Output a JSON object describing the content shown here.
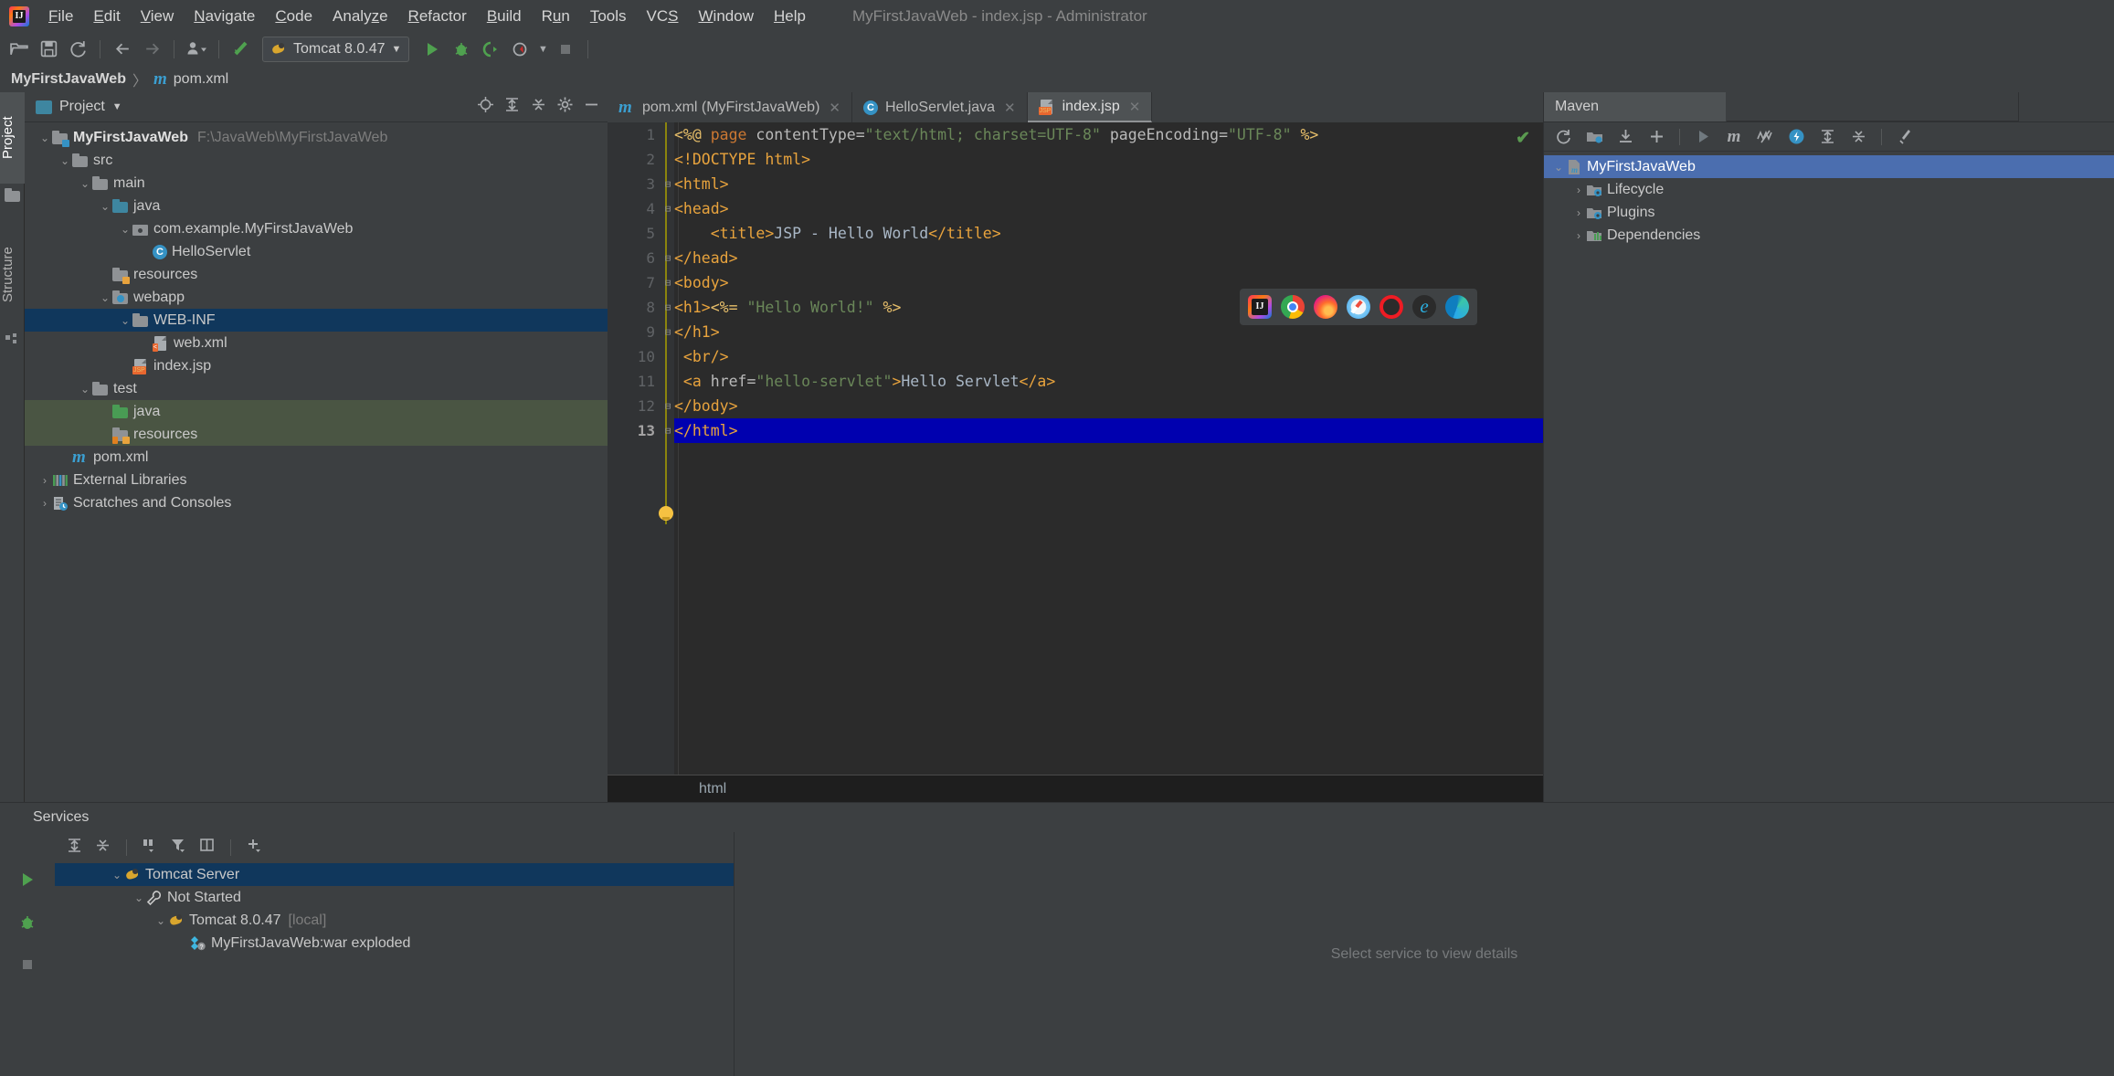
{
  "window": {
    "title": "MyFirstJavaWeb - index.jsp - Administrator"
  },
  "menubar": {
    "items": [
      {
        "label": "File",
        "mnemonic": "F"
      },
      {
        "label": "Edit",
        "mnemonic": "E"
      },
      {
        "label": "View",
        "mnemonic": "V"
      },
      {
        "label": "Navigate",
        "mnemonic": "N"
      },
      {
        "label": "Code",
        "mnemonic": "C"
      },
      {
        "label": "Analyze",
        "mnemonic": "z"
      },
      {
        "label": "Refactor",
        "mnemonic": "R"
      },
      {
        "label": "Build",
        "mnemonic": "B"
      },
      {
        "label": "Run",
        "mnemonic": "u"
      },
      {
        "label": "Tools",
        "mnemonic": "T"
      },
      {
        "label": "VCS",
        "mnemonic": "S"
      },
      {
        "label": "Window",
        "mnemonic": "W"
      },
      {
        "label": "Help",
        "mnemonic": "H"
      }
    ]
  },
  "toolbar": {
    "icons": [
      "open-folder-icon",
      "save-all-icon",
      "sync-refresh-icon",
      "back-arrow-icon",
      "forward-arrow-icon",
      "update-project-icon",
      "make-project-icon"
    ],
    "run_config": {
      "label": "Tomcat 8.0.47",
      "icon": "tomcat-icon",
      "dropdown": "chevron-down-icon"
    },
    "run_icons": [
      "run-icon",
      "debug-icon",
      "run-with-coverage-icon",
      "profile-icon",
      "stop-icon"
    ]
  },
  "breadcrumb": {
    "project": "MyFirstJavaWeb",
    "separator": "〉",
    "file": "pom.xml",
    "file_icon": "maven-m-icon"
  },
  "left_strip": {
    "tabs": [
      {
        "label": "Project",
        "selected": true,
        "icon": "project-folder-icon"
      },
      {
        "label": "Structure",
        "selected": false,
        "icon": "structure-icon"
      }
    ]
  },
  "project_pane": {
    "title": "Project",
    "dropdown_icon": "chevron-down-icon",
    "head_icons": [
      "locate-target-icon",
      "expand-all-icon",
      "collapse-all-icon",
      "gear-icon",
      "hide-icon"
    ],
    "tree": [
      {
        "indent": 0,
        "arrow": "down",
        "icon": "module-folder-icon",
        "label": "MyFirstJavaWeb",
        "bold": true,
        "path": "F:\\JavaWeb\\MyFirstJavaWeb",
        "state": "none"
      },
      {
        "indent": 1,
        "arrow": "down",
        "icon": "folder-icon",
        "label": "src",
        "bold": false,
        "path": "",
        "state": "none"
      },
      {
        "indent": 2,
        "arrow": "down",
        "icon": "folder-icon",
        "label": "main",
        "bold": false,
        "path": "",
        "state": "none"
      },
      {
        "indent": 3,
        "arrow": "down",
        "icon": "source-folder-icon",
        "label": "java",
        "bold": false,
        "path": "",
        "state": "none"
      },
      {
        "indent": 4,
        "arrow": "down",
        "icon": "package-icon",
        "label": "com.example.MyFirstJavaWeb",
        "bold": false,
        "path": "",
        "state": "none"
      },
      {
        "indent": 5,
        "arrow": "none",
        "icon": "java-class-icon",
        "label": "HelloServlet",
        "bold": false,
        "path": "",
        "state": "none"
      },
      {
        "indent": 3,
        "arrow": "none",
        "icon": "resources-folder-icon",
        "label": "resources",
        "bold": false,
        "path": "",
        "state": "none"
      },
      {
        "indent": 3,
        "arrow": "down",
        "icon": "webapp-folder-icon",
        "label": "webapp",
        "bold": false,
        "path": "",
        "state": "none"
      },
      {
        "indent": 4,
        "arrow": "down",
        "icon": "folder-icon",
        "label": "WEB-INF",
        "bold": false,
        "path": "",
        "state": "selected-blue"
      },
      {
        "indent": 5,
        "arrow": "none",
        "icon": "xml-file-icon",
        "label": "web.xml",
        "bold": false,
        "path": "",
        "state": "none"
      },
      {
        "indent": 4,
        "arrow": "none",
        "icon": "jsp-file-icon",
        "label": "index.jsp",
        "bold": false,
        "path": "",
        "state": "none"
      },
      {
        "indent": 2,
        "arrow": "down",
        "icon": "folder-icon",
        "label": "test",
        "bold": false,
        "path": "",
        "state": "none"
      },
      {
        "indent": 3,
        "arrow": "none",
        "icon": "test-source-folder-icon",
        "label": "java",
        "bold": false,
        "path": "",
        "state": "selected-green"
      },
      {
        "indent": 3,
        "arrow": "none",
        "icon": "test-resources-folder-icon",
        "label": "resources",
        "bold": false,
        "path": "",
        "state": "selected-green"
      },
      {
        "indent": 1,
        "arrow": "none",
        "icon": "maven-m-icon",
        "label": "pom.xml",
        "bold": false,
        "path": "",
        "state": "none"
      },
      {
        "indent": 0,
        "arrow": "right",
        "icon": "external-libraries-icon",
        "label": "External Libraries",
        "bold": false,
        "path": "",
        "state": "none"
      },
      {
        "indent": 0,
        "arrow": "right",
        "icon": "scratches-icon",
        "label": "Scratches and Consoles",
        "bold": false,
        "path": "",
        "state": "none"
      }
    ]
  },
  "editor": {
    "tabs": [
      {
        "label": "pom.xml (MyFirstJavaWeb)",
        "icon": "maven-m-icon",
        "active": false,
        "close": "close-icon"
      },
      {
        "label": "HelloServlet.java",
        "icon": "java-class-icon",
        "active": false,
        "close": "close-icon"
      },
      {
        "label": "index.jsp",
        "icon": "jsp-file-icon",
        "active": true,
        "close": "close-icon"
      }
    ],
    "current_line": 13,
    "inspection_status": "ok-checkmark-icon",
    "bottom_breadcrumb": "html",
    "browser_popup": {
      "icons": [
        {
          "name": "intellij-browser-icon",
          "color": "#e6387f"
        },
        {
          "name": "chrome-browser-icon",
          "color": "#4285f4"
        },
        {
          "name": "firefox-browser-icon",
          "color": "#ff7139"
        },
        {
          "name": "safari-browser-icon",
          "color": "#3fa9f5"
        },
        {
          "name": "opera-browser-icon",
          "color": "#ee1c24"
        },
        {
          "name": "internet-explorer-browser-icon",
          "color": "#2baee0"
        },
        {
          "name": "edge-browser-icon",
          "color": "#28a8ea"
        }
      ]
    },
    "lines": [
      {
        "n": 1,
        "fold": "",
        "segs": [
          {
            "t": "<%@ ",
            "c": "tag"
          },
          {
            "t": "page ",
            "c": "kw"
          },
          {
            "t": "contentType=",
            "c": "attr"
          },
          {
            "t": "\"text/html; charset=UTF-8\"",
            "c": "str"
          },
          {
            "t": " ",
            "c": "attr"
          },
          {
            "t": "pageEncoding=",
            "c": "attr"
          },
          {
            "t": "\"UTF-8\"",
            "c": "str"
          },
          {
            "t": " %>",
            "c": "tag"
          }
        ]
      },
      {
        "n": 2,
        "fold": "",
        "segs": [
          {
            "t": "<!DOCTYPE html>",
            "c": "tagb"
          }
        ]
      },
      {
        "n": 3,
        "fold": "minus",
        "segs": [
          {
            "t": "<html>",
            "c": "tagb"
          }
        ]
      },
      {
        "n": 4,
        "fold": "minus",
        "segs": [
          {
            "t": "<head>",
            "c": "tagb"
          }
        ]
      },
      {
        "n": 5,
        "fold": "",
        "segs": [
          {
            "t": "    <title>",
            "c": "tagb"
          },
          {
            "t": "JSP - Hello World",
            "c": "txt"
          },
          {
            "t": "</title>",
            "c": "tagb"
          }
        ]
      },
      {
        "n": 6,
        "fold": "end",
        "segs": [
          {
            "t": "</head>",
            "c": "tagb"
          }
        ]
      },
      {
        "n": 7,
        "fold": "minus",
        "segs": [
          {
            "t": "<body>",
            "c": "tagb"
          }
        ]
      },
      {
        "n": 8,
        "fold": "minus",
        "segs": [
          {
            "t": "<h1>",
            "c": "tagb"
          },
          {
            "t": "<%= ",
            "c": "tag"
          },
          {
            "t": "\"Hello World!\"",
            "c": "str"
          },
          {
            "t": " %>",
            "c": "tag"
          }
        ]
      },
      {
        "n": 9,
        "fold": "end",
        "segs": [
          {
            "t": "</h1>",
            "c": "tagb"
          }
        ]
      },
      {
        "n": 10,
        "fold": "",
        "segs": [
          {
            "t": " <br/>",
            "c": "tagb"
          }
        ]
      },
      {
        "n": 11,
        "fold": "",
        "segs": [
          {
            "t": " <a ",
            "c": "tagb"
          },
          {
            "t": "href=",
            "c": "attr"
          },
          {
            "t": "\"hello-servlet\"",
            "c": "str"
          },
          {
            "t": ">",
            "c": "tagb"
          },
          {
            "t": "Hello Servlet",
            "c": "txt"
          },
          {
            "t": "</a>",
            "c": "tagb"
          }
        ]
      },
      {
        "n": 12,
        "fold": "end",
        "segs": [
          {
            "t": "</body>",
            "c": "tagb"
          }
        ]
      },
      {
        "n": 13,
        "fold": "end",
        "segs": [
          {
            "t": "</html>",
            "c": "tagb"
          }
        ]
      }
    ]
  },
  "maven_pane": {
    "tab_label": "Maven",
    "toolbar_icons": [
      "reimport-icon",
      "generate-sources-icon",
      "download-sources-icon",
      "add-maven-project-icon",
      "run-icon",
      "execute-maven-goal-icon",
      "toggle-offline-icon",
      "toggle-skip-tests-icon",
      "expand-all-icon",
      "collapse-all-icon",
      "maven-settings-icon"
    ],
    "tree": [
      {
        "indent": 0,
        "arrow": "down",
        "icon": "maven-project-icon",
        "label": "MyFirstJavaWeb",
        "selected": true
      },
      {
        "indent": 1,
        "arrow": "right",
        "icon": "lifecycle-folder-icon",
        "label": "Lifecycle",
        "selected": false
      },
      {
        "indent": 1,
        "arrow": "right",
        "icon": "plugins-folder-icon",
        "label": "Plugins",
        "selected": false
      },
      {
        "indent": 1,
        "arrow": "right",
        "icon": "dependencies-folder-icon",
        "label": "Dependencies",
        "selected": false
      }
    ]
  },
  "services_pane": {
    "title": "Services",
    "left_icons": [
      "run-icon",
      "debug-icon",
      "stop-icon"
    ],
    "toolbar_icons": [
      "run-icon",
      "expand-all-icon",
      "collapse-all-icon",
      "group-by-icon",
      "filter-icon",
      "show-configurations-icon",
      "add-service-icon"
    ],
    "tree": [
      {
        "indent": 0,
        "arrow": "down",
        "icon": "tomcat-icon",
        "label": "Tomcat Server",
        "suffix": "",
        "selected": true
      },
      {
        "indent": 1,
        "arrow": "down",
        "icon": "wrench-icon",
        "label": "Not Started",
        "suffix": "",
        "selected": false
      },
      {
        "indent": 2,
        "arrow": "down",
        "icon": "tomcat-icon",
        "label": "Tomcat 8.0.47",
        "suffix": "[local]",
        "selected": false
      },
      {
        "indent": 3,
        "arrow": "none",
        "icon": "artifact-icon",
        "label": "MyFirstJavaWeb:war exploded",
        "suffix": "",
        "selected": false
      }
    ],
    "detail_placeholder": "Select service to view details"
  },
  "colors": {
    "background": "#3c3f41",
    "editor_background": "#2b2b2b",
    "selection_blue": "#10375c",
    "selection_green": "#4a5543",
    "maven_selected": "#4b6eaf",
    "current_line": "#0000af",
    "accent_blue": "#3592c4",
    "accent_green": "#499c54",
    "accent_orange": "#cc7832"
  }
}
